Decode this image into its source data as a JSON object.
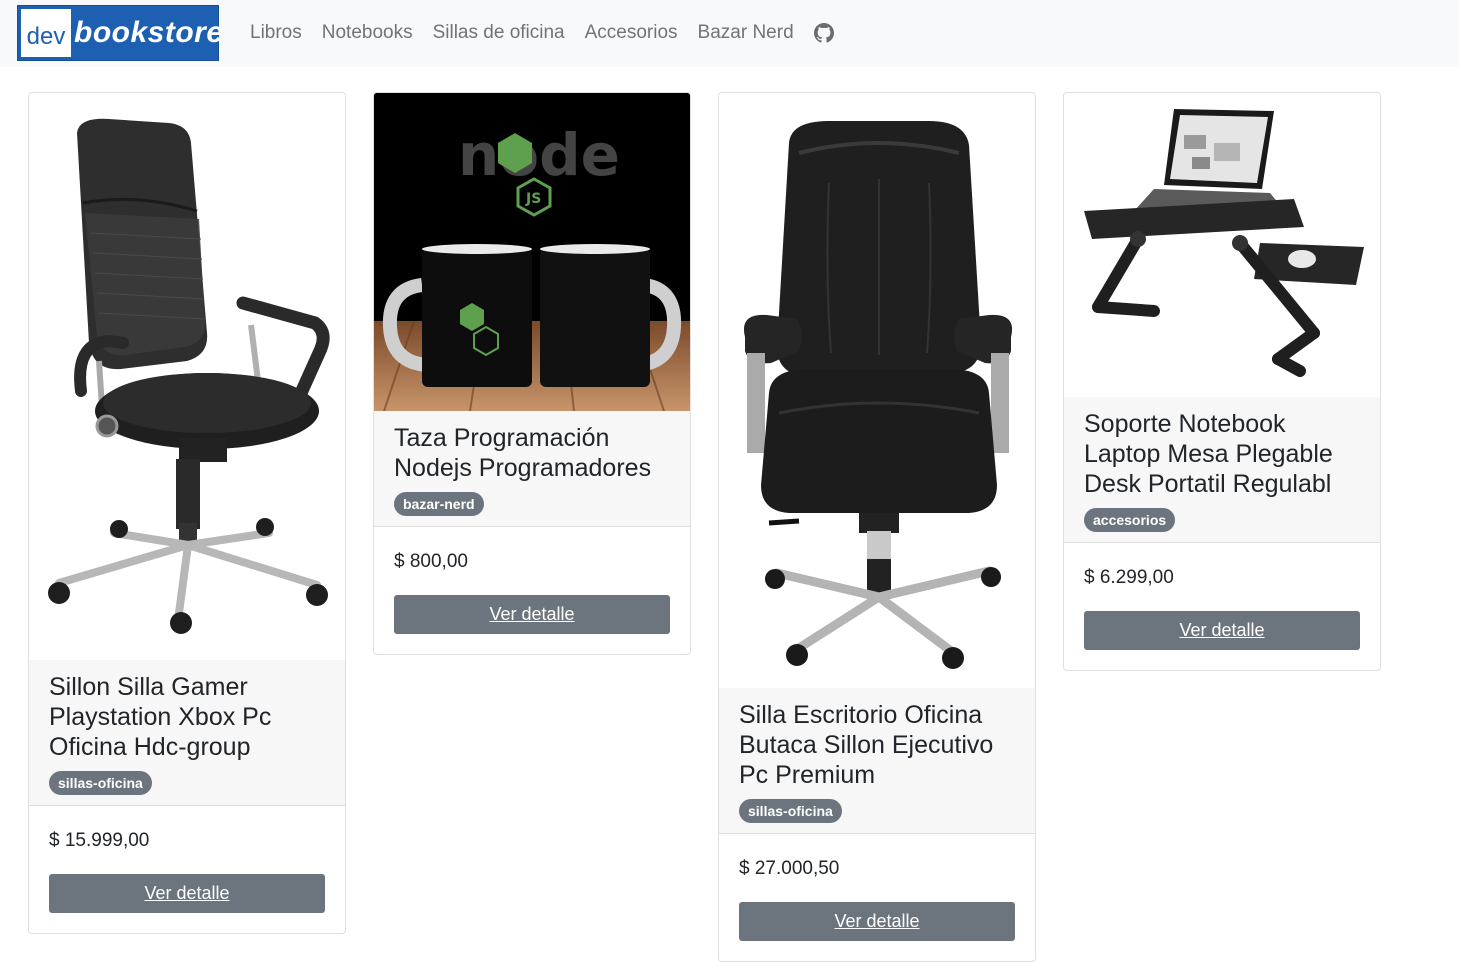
{
  "navbar": {
    "brand_prefix": "dev",
    "brand_name": "bookstore",
    "links": [
      "Libros",
      "Notebooks",
      "Sillas de oficina",
      "Accesorios",
      "Bazar Nerd"
    ],
    "github_icon": "github-icon"
  },
  "products": [
    {
      "title": "Sillon Silla Gamer Playstation Xbox Pc Oficina Hdc-group",
      "category": "sillas-oficina",
      "price": "$ 15.999,00",
      "button": "Ver detalle",
      "image": "mesh-office-chair-image"
    },
    {
      "title": "Taza Programación Nodejs Programadores",
      "category": "bazar-nerd",
      "price": "$ 800,00",
      "button": "Ver detalle",
      "image": "nodejs-mugs-image",
      "image_text": "node"
    },
    {
      "title": "Silla Escritorio Oficina Butaca Sillon Ejecutivo Pc Premium",
      "category": "sillas-oficina",
      "price": "$ 27.000,50",
      "button": "Ver detalle",
      "image": "leather-executive-chair-image"
    },
    {
      "title": "Soporte Notebook Laptop Mesa Plegable Desk Portatil Regulabl",
      "category": "accesorios",
      "price": "$ 6.299,00",
      "button": "Ver detalle",
      "image": "laptop-desk-stand-image"
    }
  ],
  "colors": {
    "navbar_bg": "#f8f9fa",
    "brand_blue": "#1d5fb0",
    "secondary": "#6c757d",
    "node_green": "#5fa04e"
  }
}
